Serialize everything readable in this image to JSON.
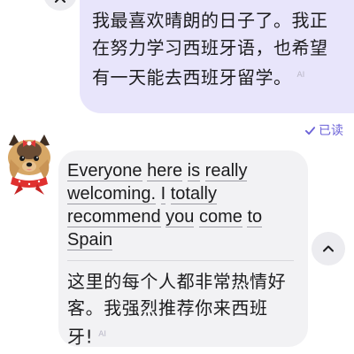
{
  "outgoing_message": {
    "text": "我最喜欢晴朗的日子了。我正在努力学习西班牙语，也希望有一天能去西班牙留学。",
    "ai_label": "AI"
  },
  "read_status": {
    "label": "已读",
    "icon": "check-icon",
    "color": "#6c63d8"
  },
  "incoming_message": {
    "avatar": "yorkie-dog-avatar",
    "original_words": [
      "Everyone",
      "here",
      "is",
      "really",
      "welcoming.",
      "I",
      "totally",
      "recommend",
      "you",
      "come",
      "to",
      "Spain"
    ],
    "translation": "这里的每个人都非常热情好客。我强烈推荐你来西班牙!",
    "ai_label": "AI"
  },
  "controls": {
    "collapse_icon": "chevron-up-icon"
  },
  "colors": {
    "outgoing_bubble": "#e8e5fb",
    "incoming_bubble": "#f2f2f4",
    "accent": "#6c63d8"
  }
}
